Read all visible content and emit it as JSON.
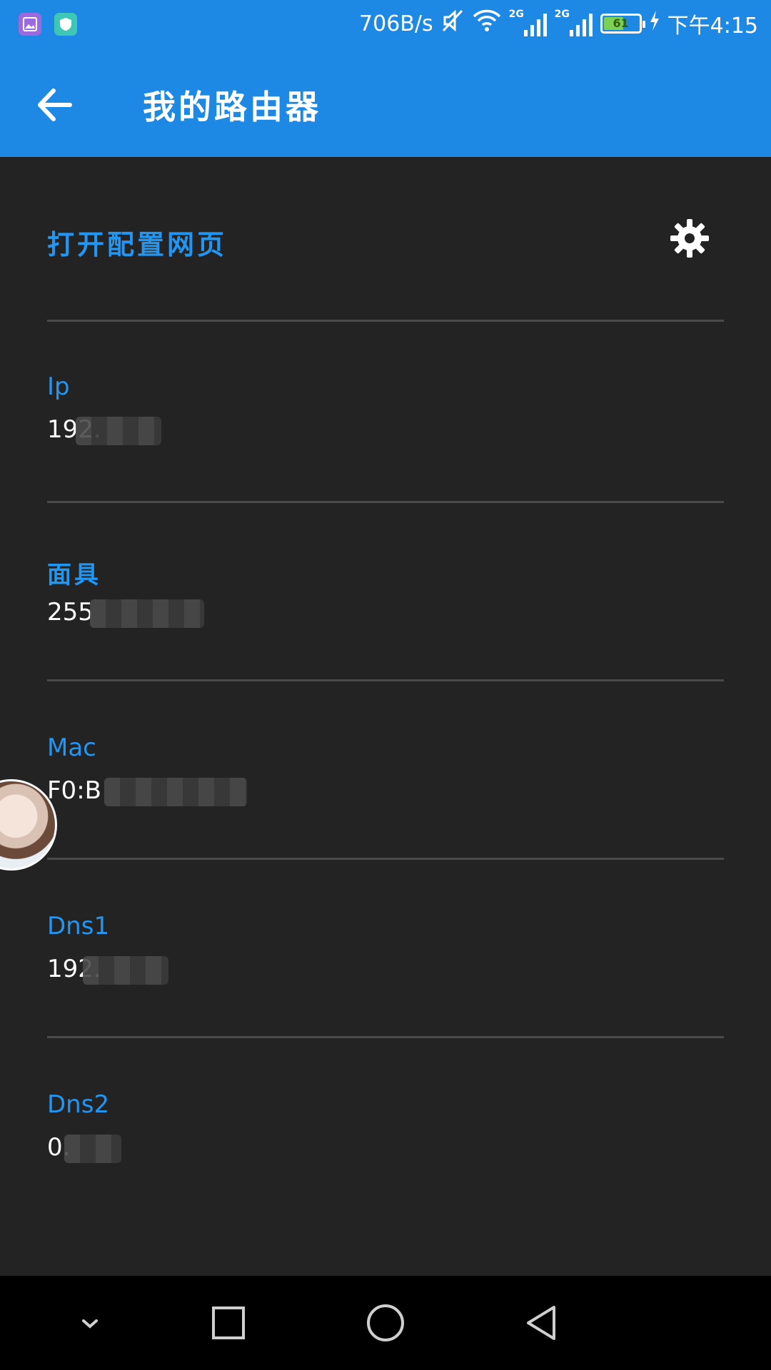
{
  "status_bar": {
    "left_icons": [
      "gallery-icon",
      "shield-icon"
    ],
    "net_speed": "706B/s",
    "signal_1_tag": "2G",
    "signal_2_tag": "2G",
    "battery_level": "61",
    "time": "下午4:15"
  },
  "app_bar": {
    "title": "我的路由器",
    "back_icon": "arrow-left-icon",
    "color": "#1e88e5"
  },
  "config": {
    "link_label": "打开配置网页",
    "settings_icon": "gear-icon"
  },
  "fields": [
    {
      "label": "Ip",
      "value": "192."
    },
    {
      "label": "面具",
      "value": "255"
    },
    {
      "label": "Mac",
      "value": "F0:B"
    },
    {
      "label": "Dns1",
      "value": "192."
    },
    {
      "label": "Dns2",
      "value": "0."
    }
  ],
  "nav_bar": {
    "buttons": [
      "chevron-down-icon",
      "recent-apps-icon",
      "home-icon",
      "back-triangle-icon"
    ]
  },
  "colors": {
    "accent": "#2196f3",
    "background": "#232323",
    "divider": "#4a4a4a"
  }
}
